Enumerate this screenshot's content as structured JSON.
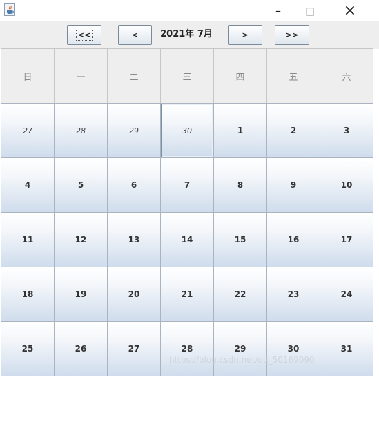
{
  "window": {
    "minimize_glyph": "–",
    "maximize_glyph": "□",
    "close_glyph": "×"
  },
  "nav": {
    "prev_year_label": "<<",
    "prev_month_label": "<",
    "month_label": "2021年 7月",
    "next_month_label": ">",
    "next_year_label": ">>"
  },
  "weekdays": [
    "日",
    "一",
    "二",
    "三",
    "四",
    "五",
    "六"
  ],
  "weeks": [
    [
      {
        "d": "27",
        "other": true
      },
      {
        "d": "28",
        "other": true
      },
      {
        "d": "29",
        "other": true
      },
      {
        "d": "30",
        "other": true,
        "selected": true
      },
      {
        "d": "1"
      },
      {
        "d": "2"
      },
      {
        "d": "3"
      }
    ],
    [
      {
        "d": "4"
      },
      {
        "d": "5"
      },
      {
        "d": "6"
      },
      {
        "d": "7"
      },
      {
        "d": "8"
      },
      {
        "d": "9"
      },
      {
        "d": "10"
      }
    ],
    [
      {
        "d": "11"
      },
      {
        "d": "12"
      },
      {
        "d": "13"
      },
      {
        "d": "14"
      },
      {
        "d": "15"
      },
      {
        "d": "16"
      },
      {
        "d": "17"
      }
    ],
    [
      {
        "d": "18"
      },
      {
        "d": "19"
      },
      {
        "d": "20"
      },
      {
        "d": "21"
      },
      {
        "d": "22"
      },
      {
        "d": "23"
      },
      {
        "d": "24"
      }
    ],
    [
      {
        "d": "25"
      },
      {
        "d": "26"
      },
      {
        "d": "27"
      },
      {
        "d": "28"
      },
      {
        "d": "29"
      },
      {
        "d": "30"
      },
      {
        "d": "31"
      }
    ]
  ],
  "watermark": "https://blog.csdn.net/qq_50169090",
  "colors": {
    "cell_border": "#aab4c0",
    "header_bg": "#eeeeee",
    "cell_gradient_bottom": "#cfdcec"
  }
}
